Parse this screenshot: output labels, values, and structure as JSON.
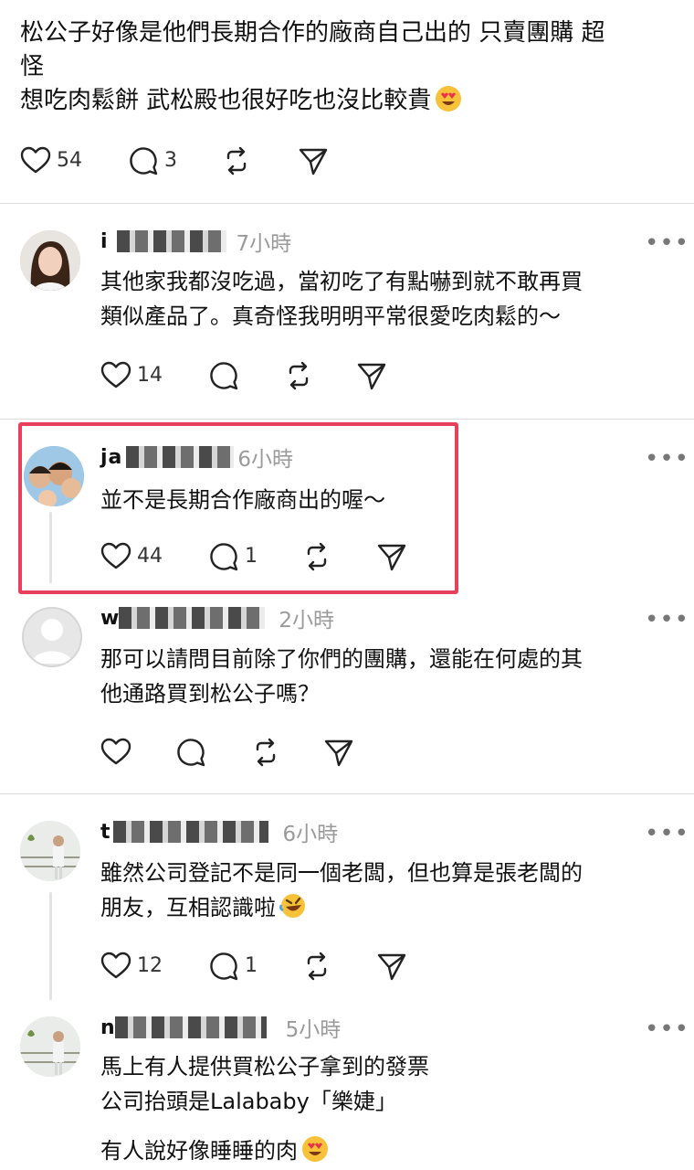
{
  "top_post": {
    "text_line1": "松公子好像是他們長期合作的廠商自己出的 只賣團購 超",
    "text_line2": "怪",
    "text_line3": "想吃肉鬆餅 武松殿也很好吃也沒比較貴",
    "emoji": "heart-eyes-emoji",
    "likes": "54",
    "replies": "3"
  },
  "replies": [
    {
      "username": "i",
      "time": "7小時",
      "text": "其他家我都沒吃過，當初吃了有點嚇到就不敢再買\n類似產品了。真奇怪我明明平常很愛吃肉鬆的～",
      "likes": "14",
      "comments": "",
      "avatar": "woman-portrait"
    },
    {
      "username": "ja",
      "time": "6小時",
      "text": "並不是長期合作廠商出的喔～",
      "likes": "44",
      "comments": "1",
      "avatar": "group-photo"
    },
    {
      "username": "w",
      "time": "2小時",
      "text": "那可以請問目前除了你們的團購，還能在何處的其\n他通路買到松公子嗎？",
      "likes": "",
      "comments": "",
      "avatar": "default-avatar"
    },
    {
      "username": "t",
      "time": "6小時",
      "text": "雖然公司登記不是同一個老闆，但也算是張老闆的\n朋友，互相認識啦",
      "emoji": "rofl-emoji",
      "likes": "12",
      "comments": "1",
      "avatar": "person-balcony"
    },
    {
      "username": "n",
      "time": "5小時",
      "text_line1": "馬上有人提供買松公子拿到的發票",
      "text_line2": "公司抬頭是Lalababy「樂婕」",
      "text_line3": "有人說好像睡睡的肉",
      "emoji": "heart-eyes-emoji",
      "avatar": "person-balcony"
    }
  ],
  "more_label": "•••",
  "icons": {
    "like": "heart-icon",
    "comment": "comment-icon",
    "repost": "repost-icon",
    "share": "send-icon"
  },
  "colors": {
    "highlight": "#e8405a",
    "time": "#9a9a9a"
  }
}
